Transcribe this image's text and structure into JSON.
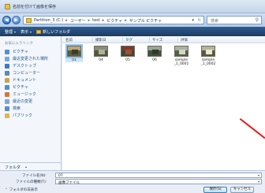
{
  "window": {
    "title": "名前を付けて画像を保存"
  },
  "address": {
    "crumbs": [
      "Partition_3 (C:)",
      "ユーザー",
      "test",
      "ピクチャ",
      "サンプル ピクチャ"
    ],
    "search_placeholder": "検索"
  },
  "toolbar": {
    "organize": "整理",
    "views": "表示",
    "new_folder": "新しいフォルダ"
  },
  "nav": {
    "heading": "お気に入りリンク",
    "items": [
      {
        "label": "ピクチャ",
        "color": "#4e8fd6"
      },
      {
        "label": "最近変更された場所",
        "color": "#7fa7d6"
      },
      {
        "label": "デスクトップ",
        "color": "#3b7cc4"
      },
      {
        "label": "コンピューター",
        "color": "#5d86b8"
      },
      {
        "label": "ドキュメント",
        "color": "#c9a24a"
      },
      {
        "label": "ピクチャ",
        "color": "#4e8fd6"
      },
      {
        "label": "ミュージック",
        "color": "#d07a3a"
      },
      {
        "label": "最近の変更",
        "color": "#7fa7d6"
      },
      {
        "label": "検索",
        "color": "#5a8ad0"
      },
      {
        "label": "パブリック",
        "color": "#e0b64a"
      }
    ]
  },
  "columns": [
    "名前",
    "撮影日",
    "タグ",
    "サイズ",
    "評価"
  ],
  "files": [
    {
      "label": "01",
      "selected": true
    },
    {
      "label": "04",
      "selected": false
    },
    {
      "label": "05",
      "selected": false
    },
    {
      "label": "06",
      "selected": false
    },
    {
      "label": "sample _1_0001",
      "selected": false
    },
    {
      "label": "sample _1_0002",
      "selected": false
    }
  ],
  "folders_toggle": "フォルダ",
  "form": {
    "filename_label": "ファイル名(N):",
    "filename_value": "07",
    "filetype_label": "ファイルの種類(T):",
    "filetype_value": "画像ファイル",
    "hide_folders": "フォルダの非表示",
    "save_button": "保存(S)",
    "cancel_button": "キャンセル"
  }
}
